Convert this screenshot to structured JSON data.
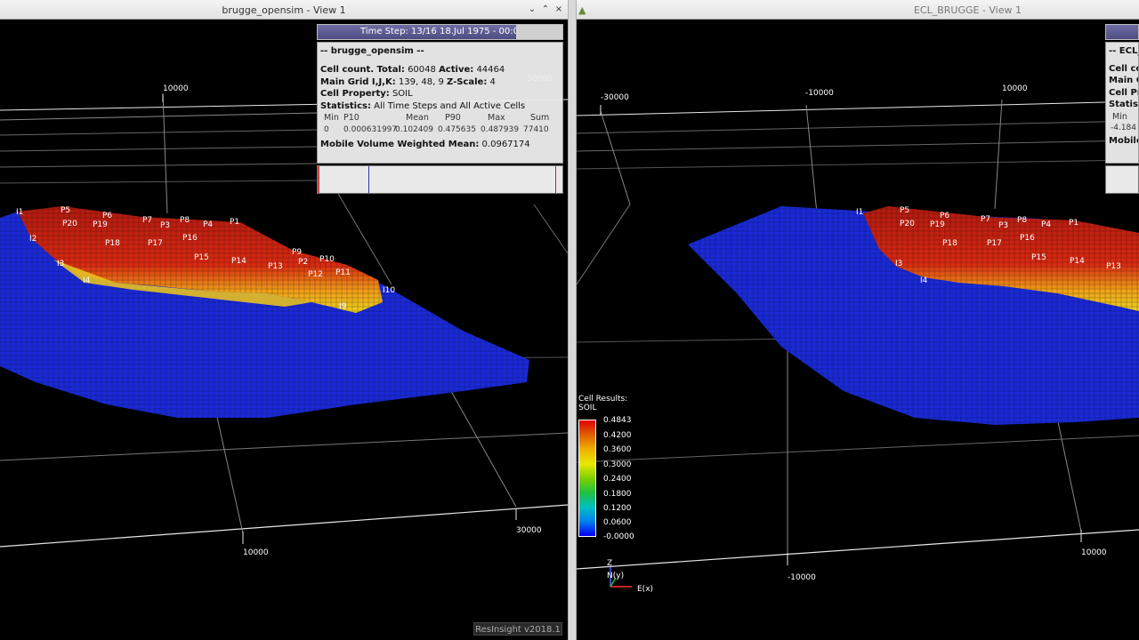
{
  "left_view": {
    "title": "brugge_opensim - View 1",
    "buttons": [
      "⌄",
      "⌃",
      "×"
    ],
    "time_step": "Time Step: 13/16 18.Jul 1975 - 00:00",
    "info": {
      "name": "-- brugge_opensim --",
      "cell_count_label": "Cell count. Total:",
      "cell_count_total": "60048",
      "active_label": "Active:",
      "active_value": "44464",
      "grid_label": "Main Grid I,J,K:",
      "grid_value": "139, 48, 9",
      "zscale_label": "Z-Scale:",
      "zscale_value": "4",
      "property_label": "Cell Property:",
      "property_value": "SOIL",
      "statistics_label": "Statistics:",
      "statistics_value": "All Time Steps and All Active Cells",
      "stat_headers": [
        "Min",
        "P10",
        "Mean",
        "P90",
        "Max",
        "Sum"
      ],
      "stat_values": [
        "0",
        "0.000631997",
        "0.102409",
        "0.475635",
        "0.487939",
        "77410"
      ],
      "mobile_label": "Mobile Volume Weighted Mean:",
      "mobile_value": "0.0967174"
    },
    "axis_labels": {
      "top_a": "10000",
      "top_b": "50000",
      "bottom_a": "10000",
      "bottom_b": "30000"
    },
    "wells": [
      "I1",
      "P5",
      "P20",
      "P19",
      "P6",
      "P7",
      "P3",
      "P8",
      "P4",
      "P1",
      "I2",
      "P18",
      "P17",
      "P16",
      "P9",
      "P2",
      "P10",
      "I3",
      "P15",
      "P14",
      "P13",
      "P12",
      "P11",
      "I4",
      "I10",
      "I9"
    ],
    "badge": "ResInsight v2018.1"
  },
  "right_view": {
    "title": "ECL_BRUGGE - View 1",
    "panel_rows": [
      "-- ECL_",
      "Cell co",
      "Main G",
      "Cell Pr",
      "Statist",
      "Min",
      "-4.184",
      "Mobile"
    ],
    "axis_labels": {
      "top_a": "-30000",
      "top_b": "-10000",
      "top_c": "10000",
      "bottom_a": "-10000",
      "bottom_b": "10000"
    },
    "wells": [
      "I1",
      "P5",
      "P20",
      "P19",
      "P6",
      "P7",
      "P3",
      "P8",
      "P4",
      "P1",
      "P18",
      "P17",
      "P16",
      "I3",
      "P15",
      "P14",
      "P13",
      "I4"
    ],
    "axes_triad": {
      "z": "Z",
      "y": "N(y)",
      "x": "E(x)"
    }
  },
  "legend": {
    "title": "Cell Results:",
    "property": "SOIL",
    "ticks": [
      "0.4843",
      "0.4200",
      "0.3600",
      "0.3000",
      "0.2400",
      "0.1800",
      "0.1200",
      "0.0600",
      "-0.0000"
    ]
  },
  "colors": {
    "reservoir_blue": "#1a2ad6",
    "oil_red": "#c81c10",
    "oil_yellow": "#e8c020",
    "info_bg": "#eeeeee",
    "timestep_bg": "#5a5a92"
  }
}
